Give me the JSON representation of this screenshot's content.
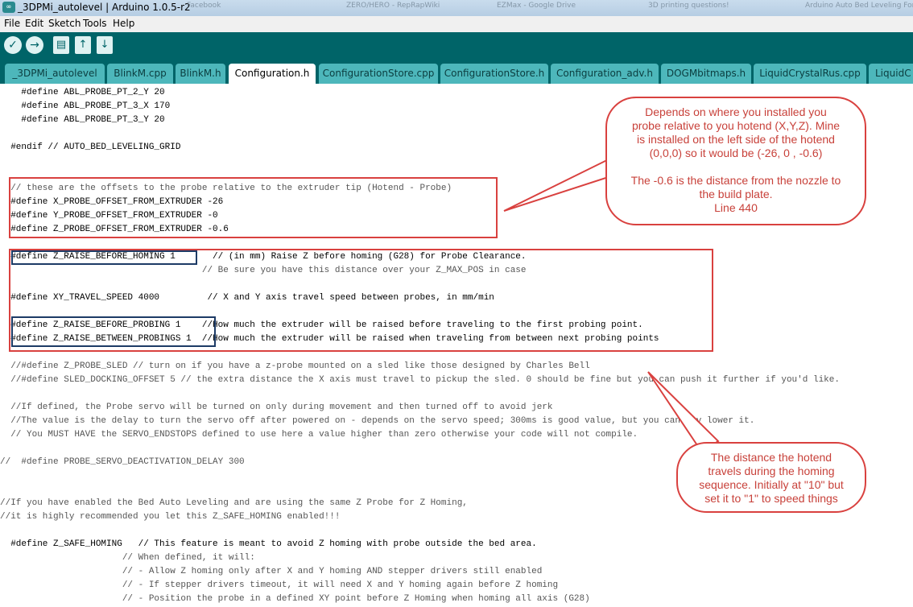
{
  "window": {
    "title": "_3DPMi_autolevel | Arduino 1.0.5-r2",
    "background_tabs": [
      "Facebook",
      "ZERO/HERO - RepRapWiki",
      "EZMax - Google Drive",
      "3D printing questions!",
      "Arduino Auto Bed Leveling For Pro"
    ]
  },
  "menu": [
    "File",
    "Edit",
    "Sketch",
    "Tools",
    "Help"
  ],
  "toolbar": {
    "verify_icon": "✓",
    "upload_icon": "→",
    "new_icon": "▤",
    "open_icon": "↑",
    "save_icon": "↓"
  },
  "tabs": [
    {
      "label": "_3DPMi_autolevel",
      "active": false
    },
    {
      "label": "BlinkM.cpp",
      "active": false
    },
    {
      "label": "BlinkM.h",
      "active": false
    },
    {
      "label": "Configuration.h",
      "active": true
    },
    {
      "label": "ConfigurationStore.cpp",
      "active": false
    },
    {
      "label": "ConfigurationStore.h",
      "active": false
    },
    {
      "label": "Configuration_adv.h",
      "active": false
    },
    {
      "label": "DOGMbitmaps.h",
      "active": false
    },
    {
      "label": "LiquidCrystalRus.cpp",
      "active": false
    },
    {
      "label": "LiquidC",
      "active": false
    }
  ],
  "code": {
    "l1": "    #define ABL_PROBE_PT_2_Y 20",
    "l2": "    #define ABL_PROBE_PT_3_X 170",
    "l3": "    #define ABL_PROBE_PT_3_Y 20",
    "l4": "  #endif // AUTO_BED_LEVELING_GRID",
    "l5": "  // these are the offsets to the probe relative to the extruder tip (Hotend - Probe)",
    "l6": "  #define X_PROBE_OFFSET_FROM_EXTRUDER -26",
    "l7": "  #define Y_PROBE_OFFSET_FROM_EXTRUDER -0",
    "l8": "  #define Z_PROBE_OFFSET_FROM_EXTRUDER -0.6",
    "l9": "  #define Z_RAISE_BEFORE_HOMING 1       // (in mm) Raise Z before homing (G28) for Probe Clearance.",
    "l10": "                                      // Be sure you have this distance over your Z_MAX_POS in case",
    "l11": "  #define XY_TRAVEL_SPEED 4000         // X and Y axis travel speed between probes, in mm/min",
    "l12": "  #define Z_RAISE_BEFORE_PROBING 1    //How much the extruder will be raised before traveling to the first probing point.",
    "l13": "  #define Z_RAISE_BETWEEN_PROBINGS 1  //How much the extruder will be raised when traveling from between next probing points",
    "l14": "  //#define Z_PROBE_SLED // turn on if you have a z-probe mounted on a sled like those designed by Charles Bell",
    "l15": "  //#define SLED_DOCKING_OFFSET 5 // the extra distance the X axis must travel to pickup the sled. 0 should be fine but you can push it further if you'd like.",
    "l16": "  //If defined, the Probe servo will be turned on only during movement and then turned off to avoid jerk",
    "l17": "  //The value is the delay to turn the servo off after powered on - depends on the servo speed; 300ms is good value, but you can try lower it.",
    "l18": "  // You MUST HAVE the SERVO_ENDSTOPS defined to use here a value higher than zero otherwise your code will not compile.",
    "l19": "//  #define PROBE_SERVO_DEACTIVATION_DELAY 300",
    "l20": "//If you have enabled the Bed Auto Leveling and are using the same Z Probe for Z Homing,",
    "l21": "//it is highly recommended you let this Z_SAFE_HOMING enabled!!!",
    "l22": "  #define Z_SAFE_HOMING   // This feature is meant to avoid Z homing with probe outside the bed area.",
    "l23": "                       // When defined, it will:",
    "l24": "                       // - Allow Z homing only after X and Y homing AND stepper drivers still enabled",
    "l25": "                       // - If stepper drivers timeout, it will need X and Y homing again before Z homing",
    "l26": "                       // - Position the probe in a defined XY point before Z Homing when homing all axis (G28)"
  },
  "callouts": {
    "offsets": [
      "Depends on where you installed you",
      "probe relative to you hotend (X,Y,Z). Mine",
      "is installed on the left side of the hotend",
      "(0,0,0) so it would be (-26, 0 , -0.6)",
      "",
      "The -0.6 is the distance from the nozzle to",
      "the build plate.",
      "Line 440"
    ],
    "homing": [
      "The distance the hotend",
      "travels during the homing",
      "sequence. Initially at \"10\" but",
      "set it to \"1\" to speed things"
    ]
  },
  "colors": {
    "teal_dark": "#006468",
    "teal_tab": "#4db7bb",
    "annotation_red": "#d9413f",
    "annotation_blue": "#1d3b66"
  }
}
